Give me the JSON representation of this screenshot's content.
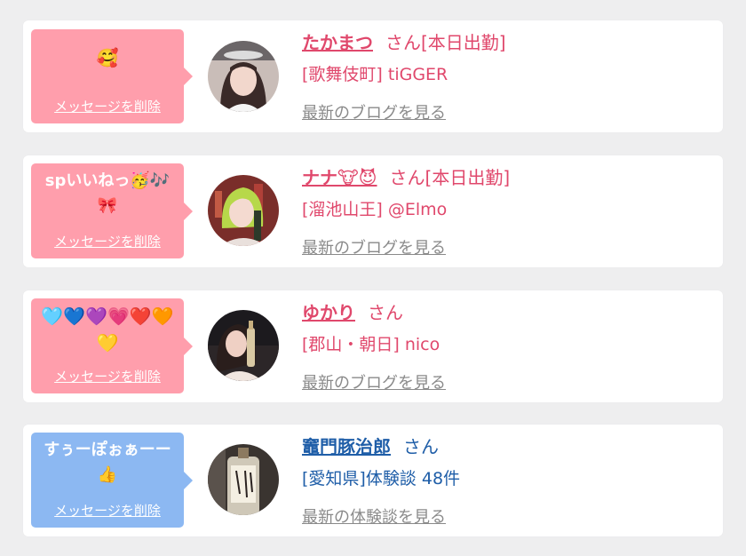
{
  "cards": [
    {
      "message": "🥰",
      "delete_label": "メッセージを削除",
      "name": "たかまつ",
      "honorific": "さん[本日出勤]",
      "sub": "[歌舞伎町] tiGGER",
      "link": "最新のブログを見る",
      "theme": "pink",
      "avatar_icon": "woman-portrait-icon"
    },
    {
      "message": "spいいねっ🥳🎶🎀",
      "delete_label": "メッセージを削除",
      "name": "ナナ🐮😈",
      "honorific": "さん[本日出勤]",
      "sub": "[溜池山王] @Elmo",
      "link": "最新のブログを見る",
      "theme": "pink",
      "avatar_icon": "green-hair-woman-icon"
    },
    {
      "message": "🩵💙💜💗❤️🧡💛",
      "delete_label": "メッセージを削除",
      "name": "ゆかり",
      "honorific": "さん",
      "sub": "[郡山・朝日] nico",
      "link": "最新のブログを見る",
      "theme": "pink",
      "avatar_icon": "woman-with-bottle-icon"
    },
    {
      "message": "すぅーぽぉぁーー👍",
      "delete_label": "メッセージを削除",
      "name": "竈門豚治郎",
      "honorific": "さん",
      "sub": "[愛知県]体験談 48件",
      "link": "最新の体験談を見る",
      "theme": "blue",
      "avatar_icon": "sake-bottle-icon"
    }
  ],
  "colors": {
    "pink_bubble": "#ff9eac",
    "blue_bubble": "#8cb8f2",
    "pink_text": "#e0486c",
    "blue_text": "#1f5ea8",
    "link_gray": "#8a8a8a"
  }
}
